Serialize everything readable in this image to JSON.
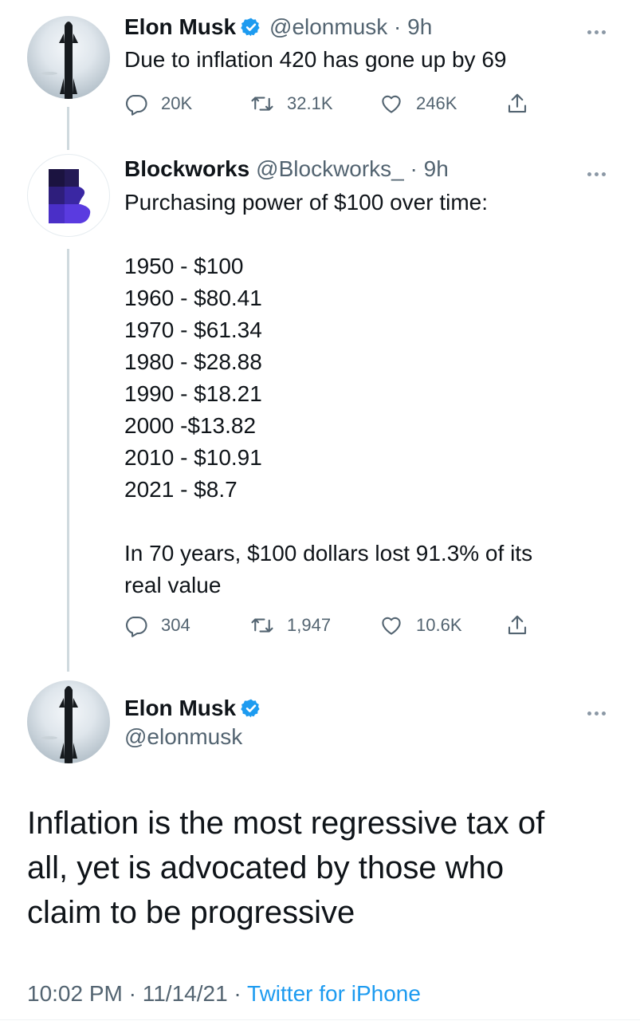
{
  "tweet1": {
    "name": "Elon Musk",
    "handle_time": "@elonmusk · 9h",
    "text": "Due to inflation 420 has gone up by 69",
    "actions": {
      "replies": "20K",
      "retweets": "32.1K",
      "likes": "246K"
    }
  },
  "tweet2": {
    "name": "Blockworks",
    "handle_time": "@Blockworks_ · 9h",
    "text": "Purchasing power of $100 over time:\n\n1950 - $100\n1960 - $80.41\n1970 - $61.34\n1980 - $28.88\n1990 - $18.21\n2000 -$13.82\n2010 - $10.91\n2021 - $8.7\n\nIn 70 years, $100 dollars lost 91.3% of its\nreal value",
    "actions": {
      "replies": "304",
      "retweets": "1,947",
      "likes": "10.6K"
    }
  },
  "main": {
    "name": "Elon Musk",
    "handle": "@elonmusk",
    "text": "Inflation is the most regressive tax of\nall, yet is advocated by those who\nclaim to be progressive",
    "time": "10:02 PM · 11/14/21 · ",
    "source": "Twitter for iPhone"
  },
  "icons": {
    "reply": "reply-icon",
    "retweet": "retweet-icon",
    "like": "heart-icon",
    "share": "share-icon",
    "more": "more-icon",
    "verified": "verified-icon"
  },
  "colors": {
    "accent": "#1d9bf0",
    "secondary_text": "#536471",
    "blockworks_purple": "#4a2fc7"
  }
}
